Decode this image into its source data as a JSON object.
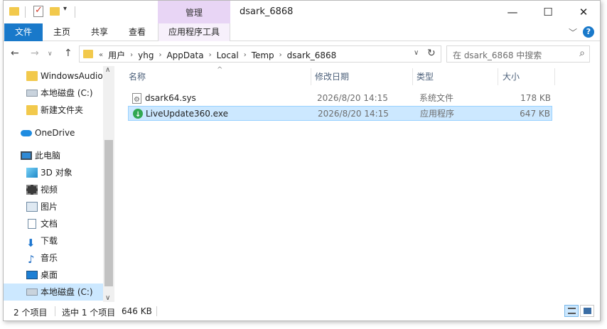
{
  "window": {
    "title": "dsark_6868",
    "context_tab_header": "管理",
    "controls": {
      "minimize": "—",
      "maximize": "☐",
      "close": "✕"
    }
  },
  "ribbon": {
    "tabs": [
      {
        "label": "文件"
      },
      {
        "label": "主页"
      },
      {
        "label": "共享"
      },
      {
        "label": "查看"
      },
      {
        "label": "应用程序工具"
      }
    ],
    "expand_glyph": "﹀",
    "help_glyph": "?"
  },
  "address": {
    "overflow_glyph": "«",
    "crumbs": [
      "用户",
      "yhg",
      "AppData",
      "Local",
      "Temp",
      "dsark_6868"
    ],
    "separator_glyph": "›",
    "dropdown_glyph": "∨",
    "refresh_glyph": "↻"
  },
  "nav_buttons": {
    "back": "←",
    "forward": "→",
    "recent": "∨",
    "up": "↑"
  },
  "search": {
    "placeholder": "在 dsark_6868 中搜索",
    "icon_glyph": "⌕"
  },
  "nav_pane": {
    "items": [
      {
        "label": "WindowsAudio",
        "icon": "folder-icon"
      },
      {
        "label": "本地磁盘 (C:)",
        "icon": "drive-icon"
      },
      {
        "label": "新建文件夹",
        "icon": "folder-icon"
      },
      {
        "label": "OneDrive",
        "icon": "cloud-icon"
      },
      {
        "label": "此电脑",
        "icon": "computer-icon"
      },
      {
        "label": "3D 对象",
        "icon": "3d-objects-icon"
      },
      {
        "label": "视频",
        "icon": "video-icon"
      },
      {
        "label": "图片",
        "icon": "pictures-icon"
      },
      {
        "label": "文档",
        "icon": "documents-icon"
      },
      {
        "label": "下载",
        "icon": "download-icon"
      },
      {
        "label": "音乐",
        "icon": "music-icon"
      },
      {
        "label": "桌面",
        "icon": "desktop-icon"
      },
      {
        "label": "本地磁盘 (C:)",
        "icon": "drive-icon"
      }
    ],
    "down_glyph": "⬇",
    "music_glyph": "♪",
    "scroll_up_glyph": "∧",
    "scroll_down_glyph": "∨"
  },
  "columns": {
    "sort_indicator": "^",
    "headers": [
      "名称",
      "修改日期",
      "类型",
      "大小"
    ]
  },
  "files": [
    {
      "name": "dsark64.sys",
      "modified": "2026/8/20 14:15",
      "type": "系统文件",
      "size": "178 KB",
      "icon": "system-file-icon",
      "selected": false
    },
    {
      "name": "LiveUpdate360.exe",
      "modified": "2026/8/20 14:15",
      "type": "应用程序",
      "size": "647 KB",
      "icon": "exe-file-icon",
      "selected": true
    }
  ],
  "status": {
    "item_count": "2 个项目",
    "selection": "选中 1 个项目",
    "selection_size": "646 KB"
  },
  "colors": {
    "accent": "#1979ca",
    "selection_bg": "#cce8ff",
    "context_tab": "#e8d5f5",
    "folder": "#f2c94c"
  }
}
